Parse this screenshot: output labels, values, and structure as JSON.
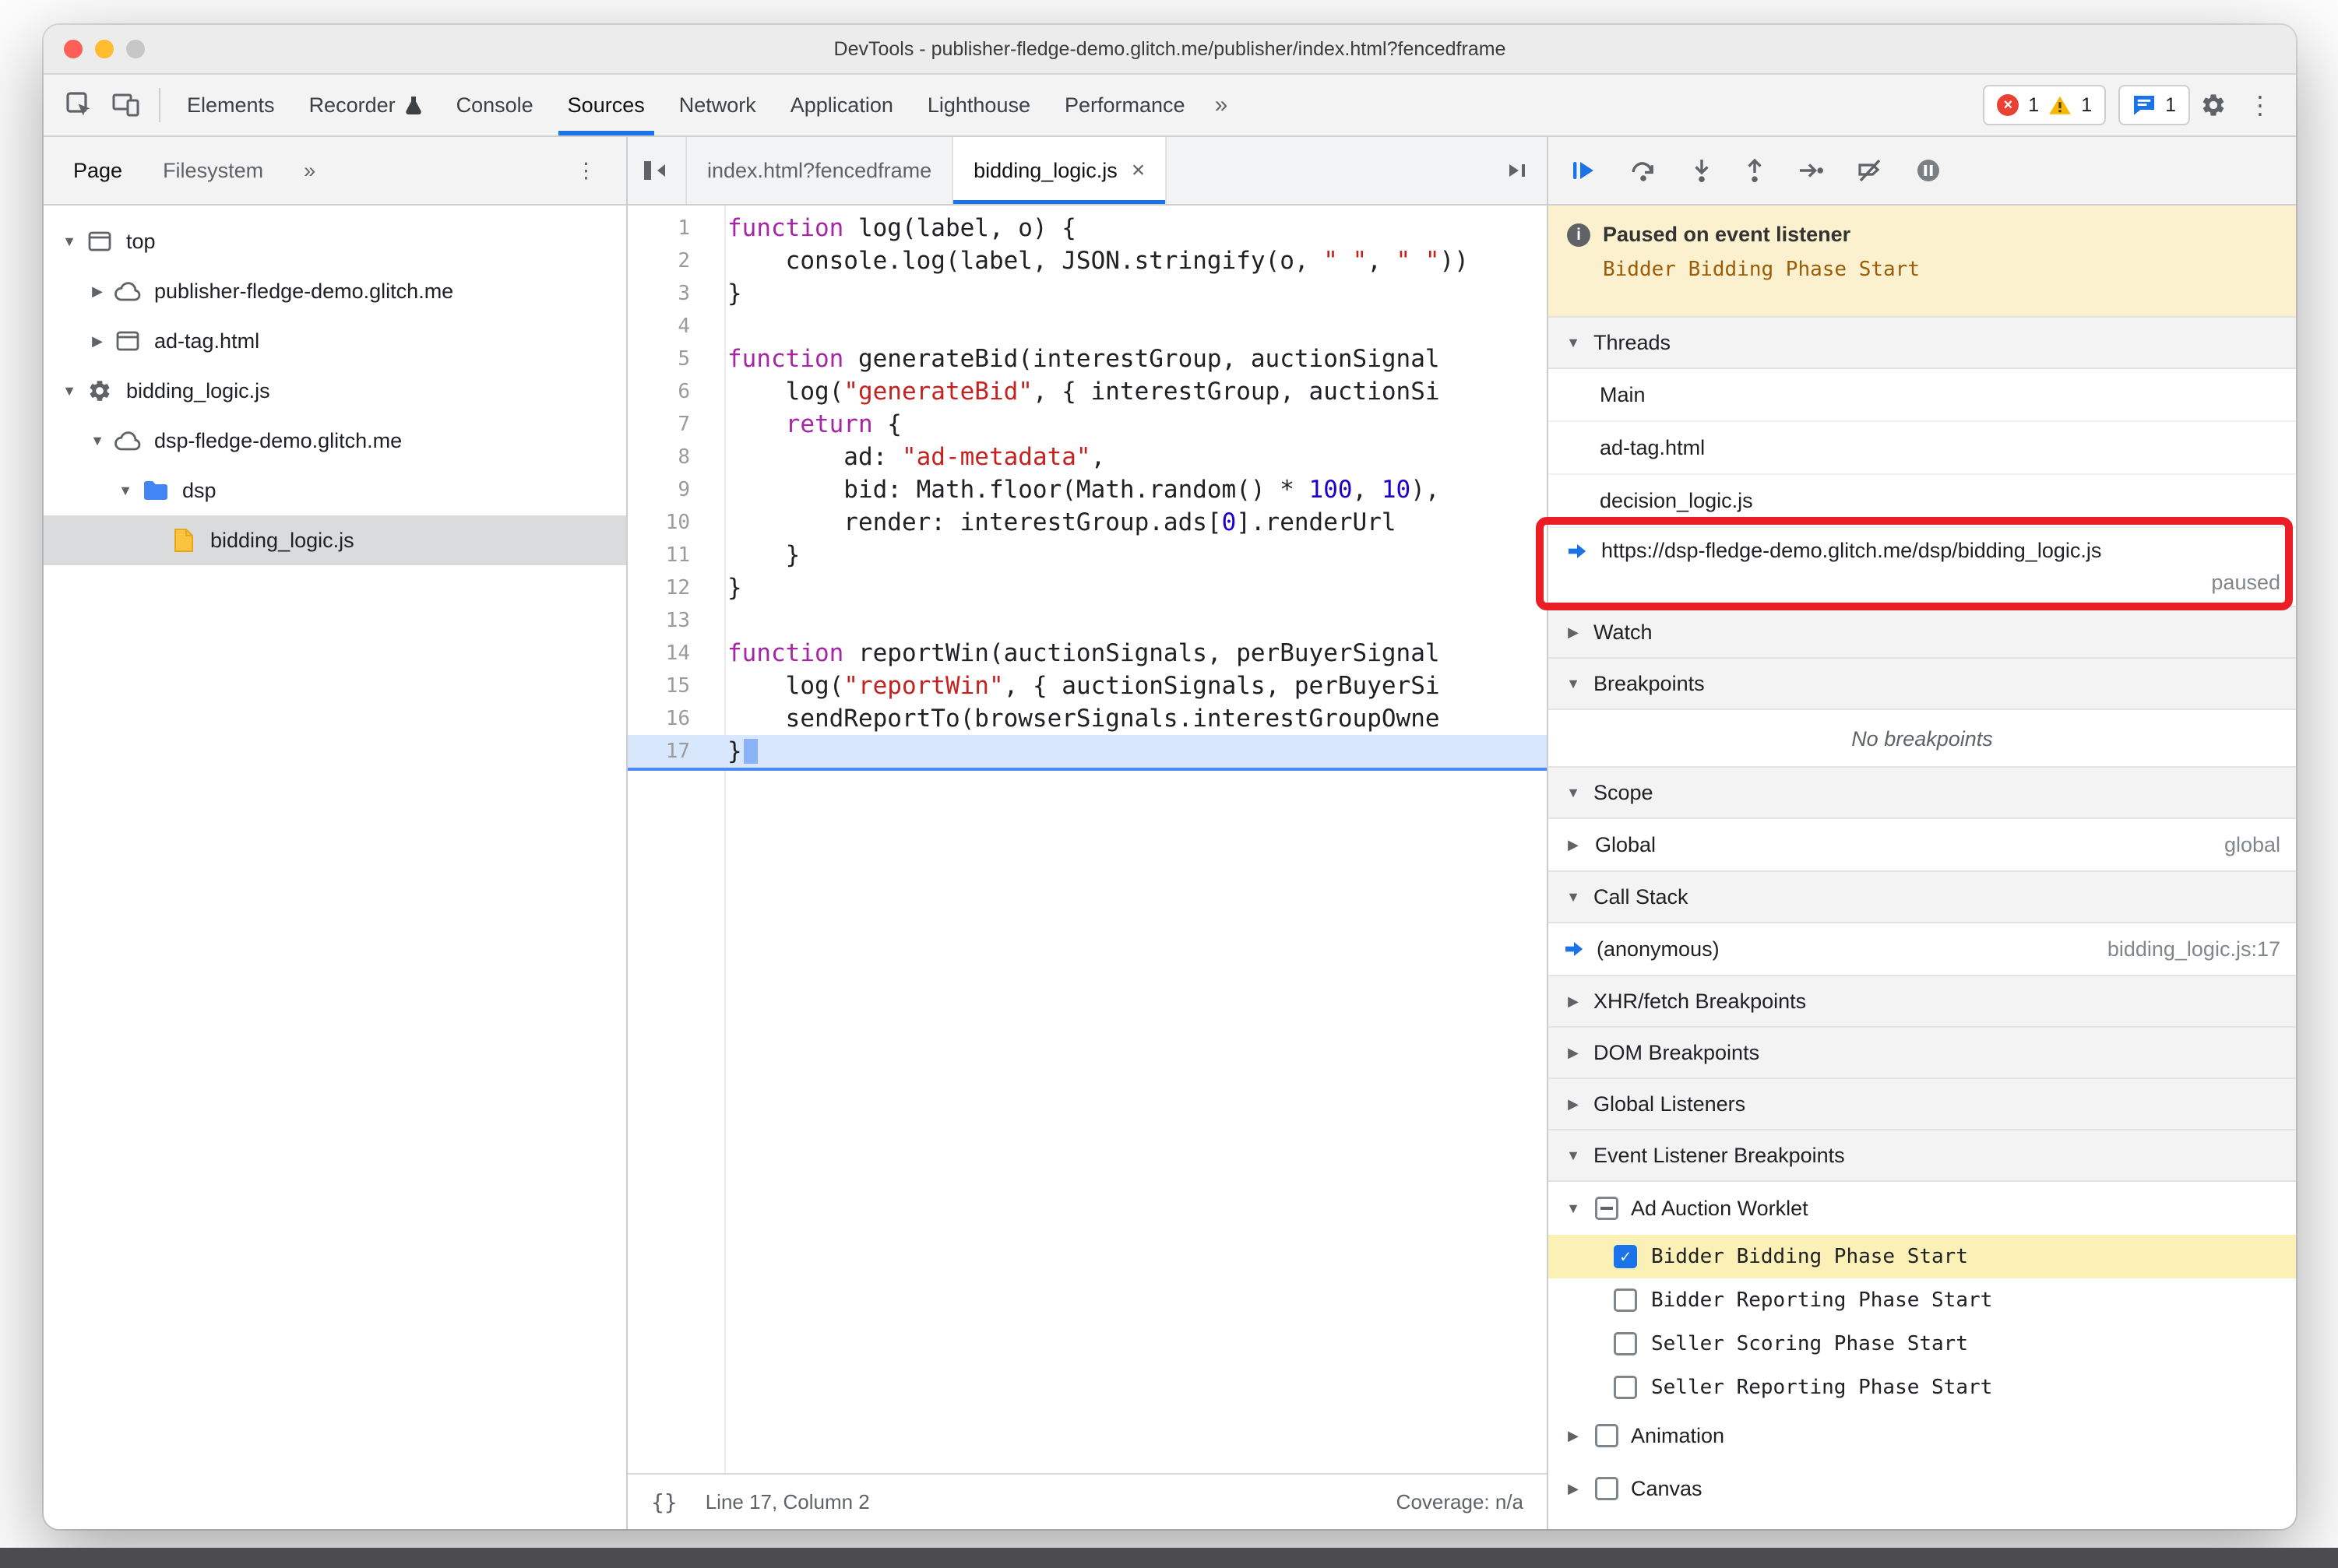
{
  "window_title": "DevTools - publisher-fledge-demo.glitch.me/publisher/index.html?fencedframe",
  "toolbar": {
    "tabs": [
      {
        "label": "Elements",
        "selected": false
      },
      {
        "label": "Recorder",
        "selected": false,
        "icon": "flask"
      },
      {
        "label": "Console",
        "selected": false
      },
      {
        "label": "Sources",
        "selected": true
      },
      {
        "label": "Network",
        "selected": false
      },
      {
        "label": "Application",
        "selected": false
      },
      {
        "label": "Lighthouse",
        "selected": false
      },
      {
        "label": "Performance",
        "selected": false
      }
    ],
    "more_tabs": "»",
    "errors_count": "1",
    "warnings_count": "1",
    "issues_count": "1"
  },
  "sidebar": {
    "tabs": [
      {
        "label": "Page",
        "selected": true
      },
      {
        "label": "Filesystem",
        "selected": false
      }
    ],
    "more": "»",
    "tree": [
      {
        "label": "top",
        "icon": "frame",
        "arrow": "expanded",
        "indent": 0
      },
      {
        "label": "publisher-fledge-demo.glitch.me",
        "icon": "cloud",
        "arrow": "collapsed",
        "indent": 1
      },
      {
        "label": "ad-tag.html",
        "icon": "frame",
        "arrow": "collapsed",
        "indent": 1
      },
      {
        "label": "bidding_logic.js",
        "icon": "gear",
        "arrow": "expanded",
        "indent": 0
      },
      {
        "label": "dsp-fledge-demo.glitch.me",
        "icon": "cloud",
        "arrow": "expanded",
        "indent": 1
      },
      {
        "label": "dsp",
        "icon": "folder",
        "arrow": "expanded",
        "indent": 2
      },
      {
        "label": "bidding_logic.js",
        "icon": "file",
        "arrow": "none",
        "indent": 3,
        "selected": true
      }
    ]
  },
  "editor": {
    "tabs": [
      {
        "label": "index.html?fencedframe",
        "active": false
      },
      {
        "label": "bidding_logic.js",
        "active": true,
        "close": "×"
      }
    ],
    "current_line": 17,
    "lines": [
      [
        [
          "kw",
          "function"
        ],
        [
          "p",
          " log(label, o) {"
        ]
      ],
      [
        [
          "p",
          "    console.log(label, JSON.stringify(o, "
        ],
        [
          "str",
          "\" \""
        ],
        [
          "p",
          ", "
        ],
        [
          "str",
          "\" \""
        ],
        [
          "p",
          "))"
        ]
      ],
      [
        [
          "p",
          "}"
        ]
      ],
      [],
      [
        [
          "kw",
          "function"
        ],
        [
          "p",
          " generateBid(interestGroup, auctionSignal"
        ]
      ],
      [
        [
          "p",
          "    log("
        ],
        [
          "str",
          "\"generateBid\""
        ],
        [
          "p",
          ", { interestGroup, auctionSi"
        ]
      ],
      [
        [
          "p",
          "    "
        ],
        [
          "kw",
          "return"
        ],
        [
          "p",
          " {"
        ]
      ],
      [
        [
          "p",
          "        ad: "
        ],
        [
          "str",
          "\"ad-metadata\""
        ],
        [
          "p",
          ","
        ]
      ],
      [
        [
          "p",
          "        bid: Math.floor(Math.random() * "
        ],
        [
          "num",
          "100"
        ],
        [
          "p",
          ", "
        ],
        [
          "num",
          "10"
        ],
        [
          "p",
          "),"
        ]
      ],
      [
        [
          "p",
          "        render: interestGroup.ads["
        ],
        [
          "num",
          "0"
        ],
        [
          "p",
          "].renderUrl"
        ]
      ],
      [
        [
          "p",
          "    }"
        ]
      ],
      [
        [
          "p",
          "}"
        ]
      ],
      [],
      [
        [
          "kw",
          "function"
        ],
        [
          "p",
          " reportWin(auctionSignals, perBuyerSignal"
        ]
      ],
      [
        [
          "p",
          "    log("
        ],
        [
          "str",
          "\"reportWin\""
        ],
        [
          "p",
          ", { auctionSignals, perBuyerSi"
        ]
      ],
      [
        [
          "p",
          "    sendReportTo(browserSignals.interestGroupOwne"
        ]
      ],
      [
        [
          "p",
          "}"
        ]
      ]
    ],
    "format_icon": "{}",
    "status_left": "Line 17, Column 2",
    "status_right": "Coverage: n/a"
  },
  "debugger": {
    "paused_title": "Paused on event listener",
    "paused_reason": "Bidder Bidding Phase Start",
    "sections": {
      "threads": "Threads",
      "watch": "Watch",
      "breakpoints": "Breakpoints",
      "scope": "Scope",
      "call_stack": "Call Stack",
      "xhr": "XHR/fetch Breakpoints",
      "dom": "DOM Breakpoints",
      "global_listeners": "Global Listeners",
      "event_listener_breakpoints": "Event Listener Breakpoints"
    },
    "threads": [
      {
        "label": "Main"
      },
      {
        "label": "ad-tag.html"
      },
      {
        "label": "decision_logic.js"
      },
      {
        "label": "https://dsp-fledge-demo.glitch.me/dsp/bidding_logic.js",
        "status": "paused",
        "active": true
      }
    ],
    "breakpoints_empty": "No breakpoints",
    "scope_rows": [
      {
        "label": "Global",
        "value": "global"
      }
    ],
    "call_stack_rows": [
      {
        "label": "(anonymous)",
        "location": "bidding_logic.js:17",
        "active": true
      }
    ],
    "event_listener_groups": [
      {
        "label": "Ad Auction Worklet",
        "expanded": true,
        "checkbox": "indeterminate",
        "children": [
          {
            "label": "Bidder Bidding Phase Start",
            "checked": true,
            "highlighted": true
          },
          {
            "label": "Bidder Reporting Phase Start",
            "checked": false
          },
          {
            "label": "Seller Scoring Phase Start",
            "checked": false
          },
          {
            "label": "Seller Reporting Phase Start",
            "checked": false
          }
        ]
      },
      {
        "label": "Animation",
        "expanded": false,
        "checkbox": "unchecked",
        "children": []
      },
      {
        "label": "Canvas",
        "expanded": false,
        "checkbox": "unchecked",
        "children": []
      }
    ]
  }
}
